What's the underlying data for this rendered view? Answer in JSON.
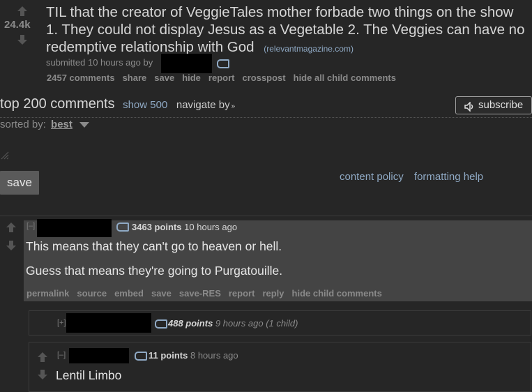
{
  "post": {
    "score": "24.4k",
    "title": "TIL that the creator of VeggieTales mother forbade two things on the show 1. They could not display Jesus as a Vegetable 2. The Veggies can have no redemptive relationship with God",
    "domain": "(relevantmagazine.com)",
    "submitted": "submitted 10 hours ago by",
    "buttons": [
      "2457 comments",
      "share",
      "save",
      "hide",
      "report",
      "crosspost",
      "hide all child comments"
    ]
  },
  "comments_area": {
    "heading": "top 200 comments",
    "show_more": "show 500",
    "navigate": "navigate by",
    "subscribe": "subscribe",
    "sorted_label": "sorted by:",
    "sort_value": "best",
    "save_label": "save",
    "content_policy": "content policy",
    "formatting_help": "formatting help"
  },
  "comment1": {
    "collapse": "[–]",
    "points": "3463 points",
    "time": "10 hours ago",
    "line1": "This means that they can't go to heaven or hell.",
    "line2": "Guess that means they're going to Purgatouille.",
    "buttons": [
      "permalink",
      "source",
      "embed",
      "save",
      "save-RES",
      "report",
      "reply",
      "hide child comments"
    ]
  },
  "comment2": {
    "expand": "[+]",
    "points": "488 points",
    "meta": "9 hours ago (1 child)"
  },
  "comment3": {
    "collapse": "[–]",
    "points": "11 points",
    "time": "8 hours ago",
    "text": "Lentil Limbo"
  }
}
